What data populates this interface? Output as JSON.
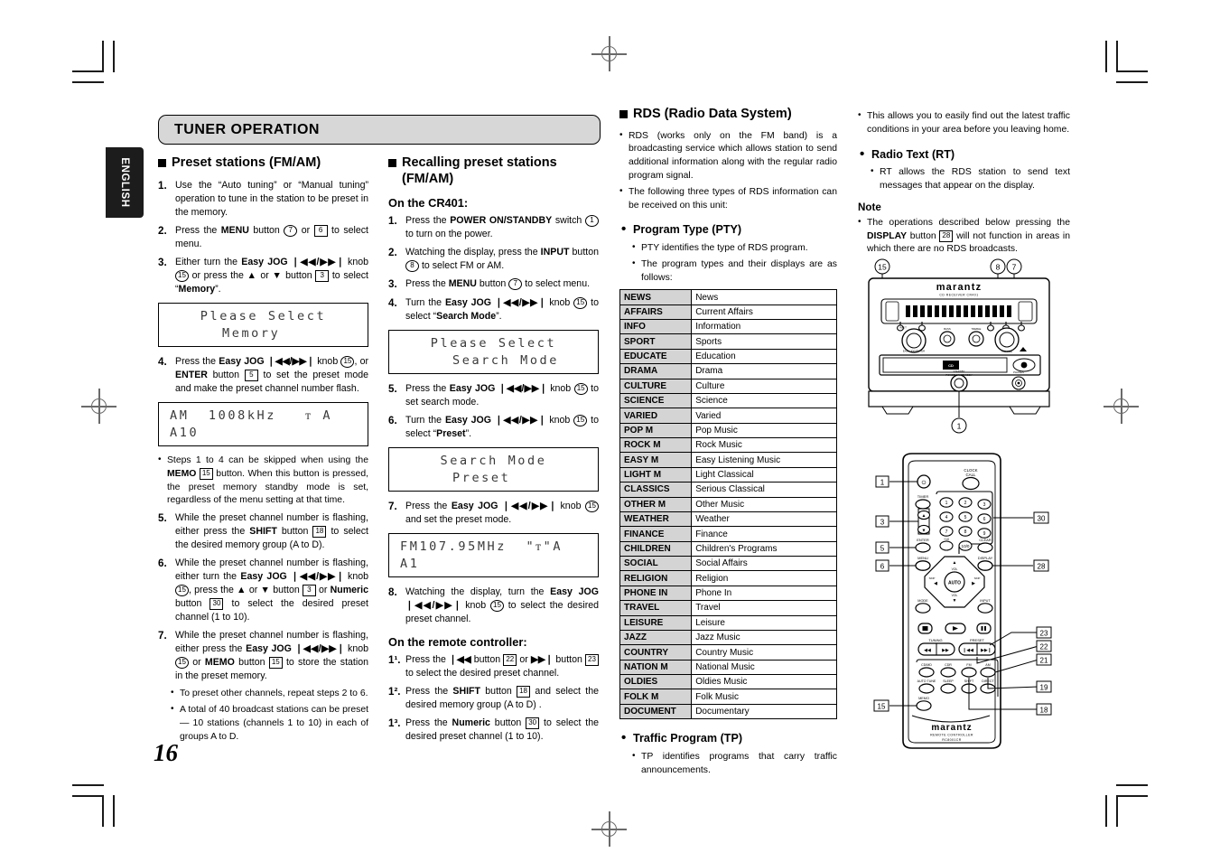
{
  "page": {
    "number": "16",
    "language_tab": "ENGLISH",
    "banner_title": "TUNER OPERATION"
  },
  "col1": {
    "heading": "Preset stations (FM/AM)",
    "steps": [
      {
        "num": "1.",
        "html": "Use the “Auto tuning” or “Manual tuning” operation to tune in the station to be preset in the memory."
      },
      {
        "num": "2.",
        "html": "Press the <b>MENU</b> button <span class=\"circnum\">7</span> or <span class=\"boxnum\">6</span> to select menu."
      },
      {
        "num": "3.",
        "html": "Either turn the <b>Easy JOG</b> <b class=\"jog\">❘◀◀/▶▶❘</b> knob <span class=\"circnum\">15</span> or press the ▲ or ▼ button <span class=\"boxnum\">3</span> to select “<b>Memory</b>”."
      },
      {
        "num": "4.",
        "html": "Press the <b>Easy JOG</b> <b class=\"jog\">❘◀◀/▶▶❘</b> knob <span class=\"circnum\">15</span>, or <b>ENTER</b> button <span class=\"boxnum\">5</span> to set the preset mode and make the preset channel number flash."
      },
      {
        "num": "5.",
        "html": "While the preset channel number is flashing, either press the <b>SHIFT</b> button <span class=\"boxnum\">18</span> to select the desired memory group (A to D)."
      },
      {
        "num": "6.",
        "html": "While the preset channel number is flashing, either turn the <b>Easy JOG</b> <b class=\"jog\">❘◀◀/▶▶❘</b> knob <span class=\"circnum\">15</span>, press the ▲ or ▼ button <span class=\"boxnum\">3</span> or <b>Numeric</b> button <span class=\"boxnum\">30</span> to select the desired preset channel (1 to 10)."
      },
      {
        "num": "7.",
        "html": "While the preset channel number is flashing, either press the <b>Easy JOG</b> <b class=\"jog\">❘◀◀/▶▶❘</b> knob <span class=\"circnum\">15</span> or <b>MEMO</b> button <span class=\"boxnum\">15</span> to store the station in the preset memory."
      }
    ],
    "lcd1": {
      "line1": "Please Select",
      "line2": "Memory"
    },
    "lcd2": {
      "line1": "AM  1008kHz   ᴛ A",
      "line2": "A10"
    },
    "note_after_4": "Steps 1 to 4 can be skipped when using the <b>MEMO</b> <span class=\"boxnum\">15</span> button. When this button is pressed, the preset memory standby mode is set, regardless of the menu setting at that time.",
    "notes_end": [
      "To preset other channels, repeat steps 2 to 6.",
      "A total of 40 broadcast stations can be preset — 10 stations (channels 1 to 10) in each of groups A to D."
    ]
  },
  "col2": {
    "heading": "Recalling preset stations (FM/AM)",
    "sub1": "On the CR401:",
    "steps": [
      {
        "num": "1.",
        "html": "Press the <b>POWER ON/STANDBY</b> switch <span class=\"circnum\">1</span> to turn on the power."
      },
      {
        "num": "2.",
        "html": "Watching the display, press the <b>INPUT</b> button <span class=\"circnum\">8</span> to select FM or AM."
      },
      {
        "num": "3.",
        "html": "Press the <b>MENU</b> button <span class=\"circnum\">7</span> to select menu."
      },
      {
        "num": "4.",
        "html": "Turn the <b>Easy JOG</b> <b class=\"jog\">❘◀◀/▶▶❘</b> knob <span class=\"circnum\">15</span> to select “<b>Search Mode</b>”."
      },
      {
        "num": "5.",
        "html": "Press the <b>Easy JOG</b> <b class=\"jog\">❘◀◀/▶▶❘</b> knob <span class=\"circnum\">15</span> to set search mode."
      },
      {
        "num": "6.",
        "html": "Turn the <b>Easy JOG</b> <b class=\"jog\">❘◀◀/▶▶❘</b> knob <span class=\"circnum\">15</span> to select “<b>Preset</b>”."
      },
      {
        "num": "7.",
        "html": "Press the <b>Easy JOG</b> <b class=\"jog\">❘◀◀/▶▶❘</b> knob <span class=\"circnum\">15</span> and set the preset mode."
      },
      {
        "num": "8.",
        "html": "Watching the display, turn the <b>Easy JOG</b> <b class=\"jog\">❘◀◀/▶▶❘</b> knob <span class=\"circnum\">15</span> to select the desired preset channel."
      }
    ],
    "lcd1": {
      "line1": "Please Select",
      "line2": "Search Mode"
    },
    "lcd2": {
      "line1": "Search Mode",
      "line2": "Preset"
    },
    "lcd3": {
      "line1": "FM107.95MHz  \"ᴛ\"A",
      "line2": "A1"
    },
    "sub2": "On the remote controller:",
    "remote_steps": [
      {
        "num": "1¹.",
        "html": "Press the <b class=\"jog\">❘◀◀</b> button <span class=\"boxnum\">22</span> or <b class=\"jog\">▶▶❘</b> button <span class=\"boxnum\">23</span> to select the desired preset channel."
      },
      {
        "num": "1².",
        "html": "Press the <b>SHIFT</b> button <span class=\"boxnum\">18</span> and select the desired memory group (A to D) ."
      },
      {
        "num": "1³.",
        "html": "Press the <b>Numeric</b> button <span class=\"boxnum\">30</span> to select the desired preset channel (1 to 10)."
      }
    ]
  },
  "col3": {
    "heading": "RDS (Radio Data System)",
    "intro_bullets": [
      "RDS (works only on the FM band) is a broadcasting service which allows station to send additional information along with the regular radio program signal.",
      "The following three types of RDS information can be received on this unit:"
    ],
    "pty_heading": "Program Type (PTY)",
    "pty_bullets": [
      "PTY identifies the type of RDS program.",
      "The program types and their displays are as follows:"
    ],
    "pty_table": [
      [
        "NEWS",
        "News"
      ],
      [
        "AFFAIRS",
        "Current Affairs"
      ],
      [
        "INFO",
        "Information"
      ],
      [
        "SPORT",
        "Sports"
      ],
      [
        "EDUCATE",
        "Education"
      ],
      [
        "DRAMA",
        "Drama"
      ],
      [
        "CULTURE",
        "Culture"
      ],
      [
        "SCIENCE",
        "Science"
      ],
      [
        "VARIED",
        "Varied"
      ],
      [
        "POP M",
        "Pop Music"
      ],
      [
        "ROCK M",
        "Rock Music"
      ],
      [
        "EASY M",
        "Easy Listening Music"
      ],
      [
        "LIGHT M",
        "Light Classical"
      ],
      [
        "CLASSICS",
        "Serious Classical"
      ],
      [
        "OTHER M",
        "Other Music"
      ],
      [
        "WEATHER",
        "Weather"
      ],
      [
        "FINANCE",
        "Finance"
      ],
      [
        "CHILDREN",
        "Children's Programs"
      ],
      [
        "SOCIAL",
        "Social Affairs"
      ],
      [
        "RELIGION",
        "Religion"
      ],
      [
        "PHONE IN",
        "Phone In"
      ],
      [
        "TRAVEL",
        "Travel"
      ],
      [
        "LEISURE",
        "Leisure"
      ],
      [
        "JAZZ",
        "Jazz Music"
      ],
      [
        "COUNTRY",
        "Country Music"
      ],
      [
        "NATION M",
        "National Music"
      ],
      [
        "OLDIES",
        "Oldies Music"
      ],
      [
        "FOLK M",
        "Folk Music"
      ],
      [
        "DOCUMENT",
        "Documentary"
      ]
    ],
    "tp_heading": "Traffic Program (TP)",
    "tp_bullets": [
      "TP identifies programs that carry traffic announcements."
    ]
  },
  "col4": {
    "top_bullets": [
      "This allows you to easily find out the latest traffic conditions in your area before you leaving home."
    ],
    "rt_heading": "Radio Text (RT)",
    "rt_bullets": [
      "RT allows the RDS station to send text messages that appear on the display."
    ],
    "note_heading": "Note",
    "note_bullets_html": [
      "The operations described below pressing the <b>DISPLAY</b> button <span class=\"boxnum\">28</span> will not function in areas in which there are no RDS broadcasts."
    ],
    "unit": {
      "brand": "marantz",
      "model_sub": "CD RECEIVER CR401",
      "callouts": [
        "15",
        "8",
        "7",
        "1"
      ]
    },
    "remote": {
      "brand": "marantz",
      "sub1": "REMOTE CONTROLLER",
      "sub2": "RC8001CR",
      "callouts_left": [
        "1",
        "3",
        "5",
        "6",
        "15"
      ],
      "callouts_right": [
        "30",
        "28",
        "23",
        "22",
        "21",
        "19",
        "18"
      ],
      "keys": {
        "clock_call": "CLOCK\nCALL",
        "timer": "TIMER",
        "enter": "ENTER",
        "menu": "MENU",
        "display": "DISPLAY",
        "clear": "CLEAR",
        "tuning": "TUNING",
        "preset": "PRESET",
        "auto_tune": "AUTO TUNE",
        "sleep": "SLEEP",
        "shift": "SHIFT",
        "direct": "DIRECT",
        "memo": "MEMO",
        "cdmd": "CD/MD",
        "cdr": "CDR",
        "fm": "FM",
        "am": "AM",
        "mode": "MODE",
        "input": "INPUT",
        "vol_up": "VOL",
        "vol_down": "VOL",
        "auto": "AUTO"
      }
    }
  }
}
